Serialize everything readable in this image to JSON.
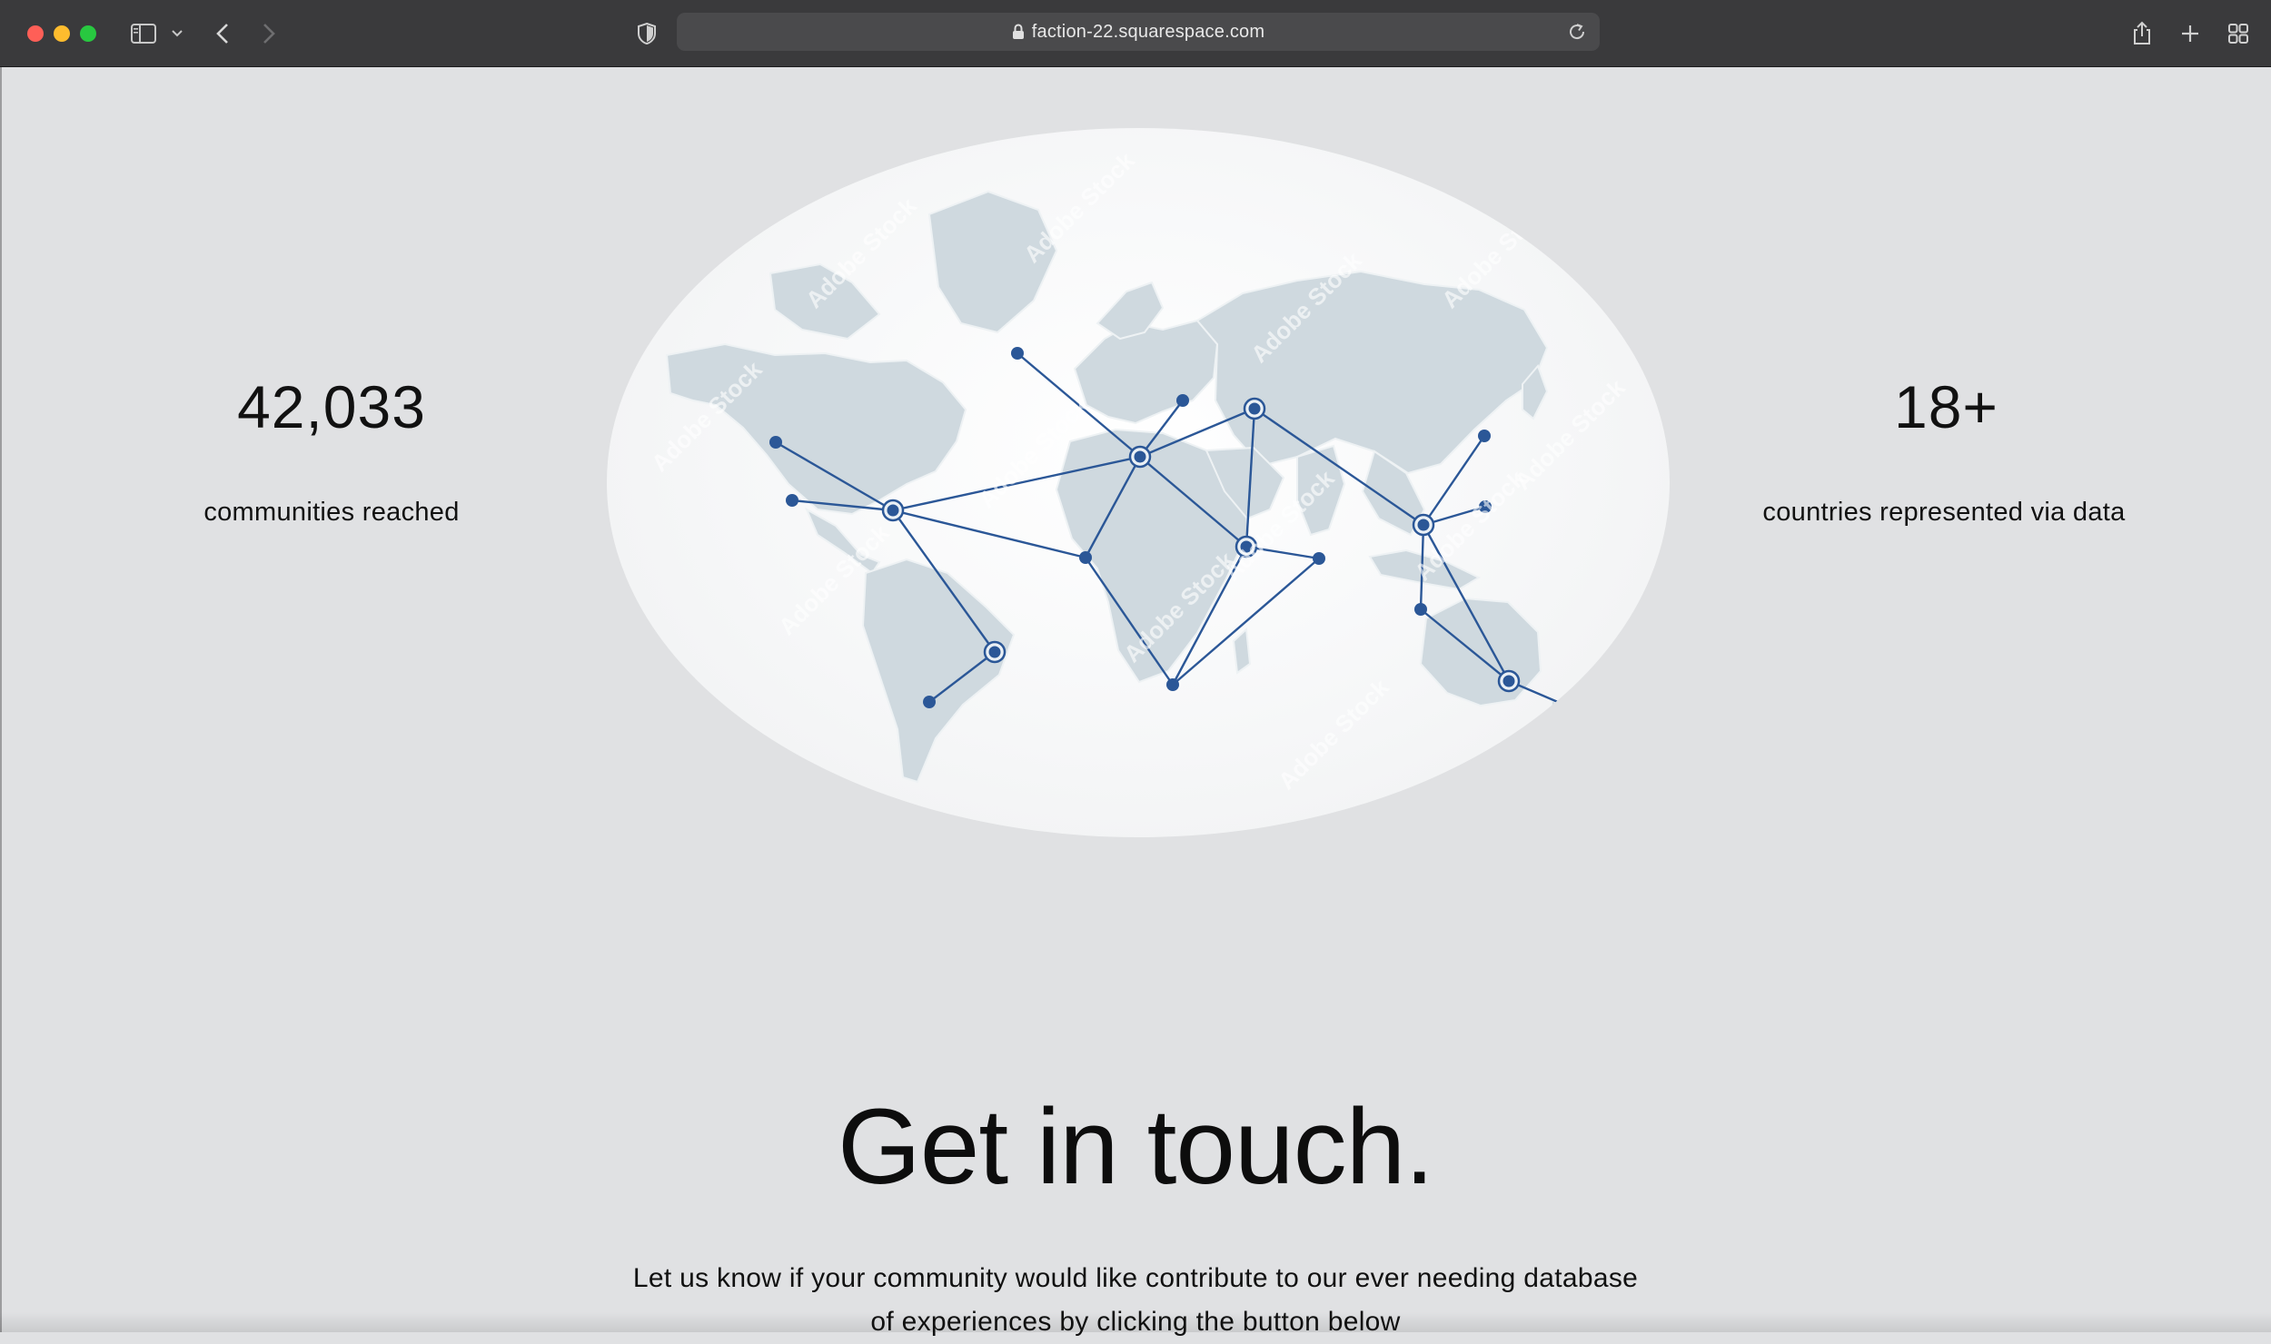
{
  "browser": {
    "url": "faction-22.squarespace.com",
    "icons": [
      "sidebar-icon",
      "chevron-down-icon",
      "back-icon",
      "forward-icon",
      "shield-icon",
      "lock-icon",
      "reload-icon",
      "share-icon",
      "new-tab-icon",
      "tab-overview-icon"
    ]
  },
  "stats": {
    "left": {
      "number": "42,033",
      "label": "communities reached"
    },
    "right": {
      "number": "18+",
      "label": "countries represented via data"
    }
  },
  "map": {
    "watermark": "Adobe Stock",
    "land_color": "#cfd9df",
    "network_color": "#2b5797"
  },
  "contact": {
    "headline": "Get in touch.",
    "paragraph_line1": "Let us know if your community would like contribute to our ever needing database",
    "paragraph_line2": "of experiences by clicking the button below"
  },
  "colors": {
    "page_background": "#e0e1e3",
    "chrome_background": "#3a3a3c"
  }
}
